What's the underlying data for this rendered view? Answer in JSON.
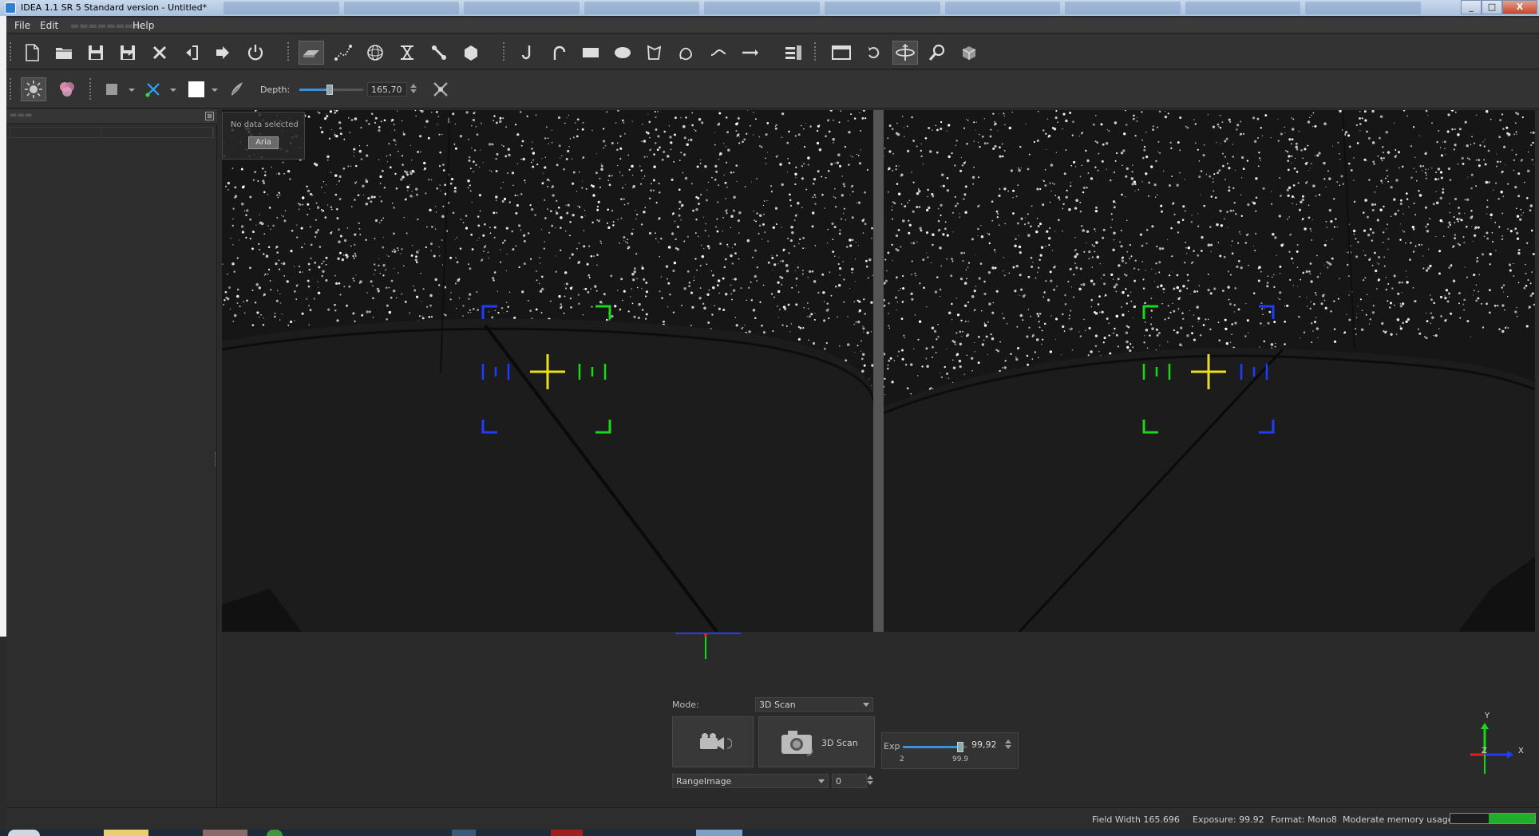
{
  "window": {
    "title": "IDEA 1.1 SR 5 Standard version - Untitled*",
    "buttons": [
      "_",
      "□",
      "X"
    ]
  },
  "menu": {
    "items": [
      "File",
      "Edit",
      "Help"
    ]
  },
  "toolbar1": {
    "icons": [
      "new-file-icon",
      "open-folder-icon",
      "save-icon",
      "save-as-icon",
      "delete-icon",
      "undo-icon",
      "redo-icon",
      "power-icon",
      "scan-layer-icon",
      "points-icon",
      "mesh-ball-icon",
      "align-icon",
      "tools-icon",
      "polygon-icon",
      "hook-icon",
      "curve-icon",
      "rectangle-icon",
      "ellipse-icon",
      "lasso-icon",
      "freeform-icon",
      "line-tool-icon",
      "arrow-line-icon",
      "list-icon",
      "window-icon",
      "rotate-icon",
      "orbit-icon",
      "zoom-icon",
      "box-view-icon"
    ]
  },
  "toolbar2": {
    "depth_label": "Depth:",
    "depth_value": "165,70",
    "depth_fraction": 0.42
  },
  "viewport": {
    "no_data_text": "No data selected",
    "no_data_button": "Aria"
  },
  "controls": {
    "mode_label": "Mode:",
    "mode_value": "3D Scan",
    "scan_button_label": "3D Scan",
    "exp_label": "Exp",
    "exp_value": "99,92",
    "exp_min": "2",
    "exp_max": "99.9",
    "exp_fraction": 0.9,
    "range_label": "RangeImage",
    "range_value": "0"
  },
  "axes": {
    "y": "Y",
    "x": "X",
    "z": "Z"
  },
  "status": {
    "field_width": "Field Width 165.696",
    "exposure": "Exposure: 99.92",
    "format": "Format: Mono8",
    "memory": "Moderate memory usage",
    "memory_fraction": 0.55
  },
  "colors": {
    "target_blue": "#1f3cff",
    "target_green": "#18d818",
    "crosshair_yellow": "#e8e020",
    "memory_green": "#1fae2b"
  }
}
